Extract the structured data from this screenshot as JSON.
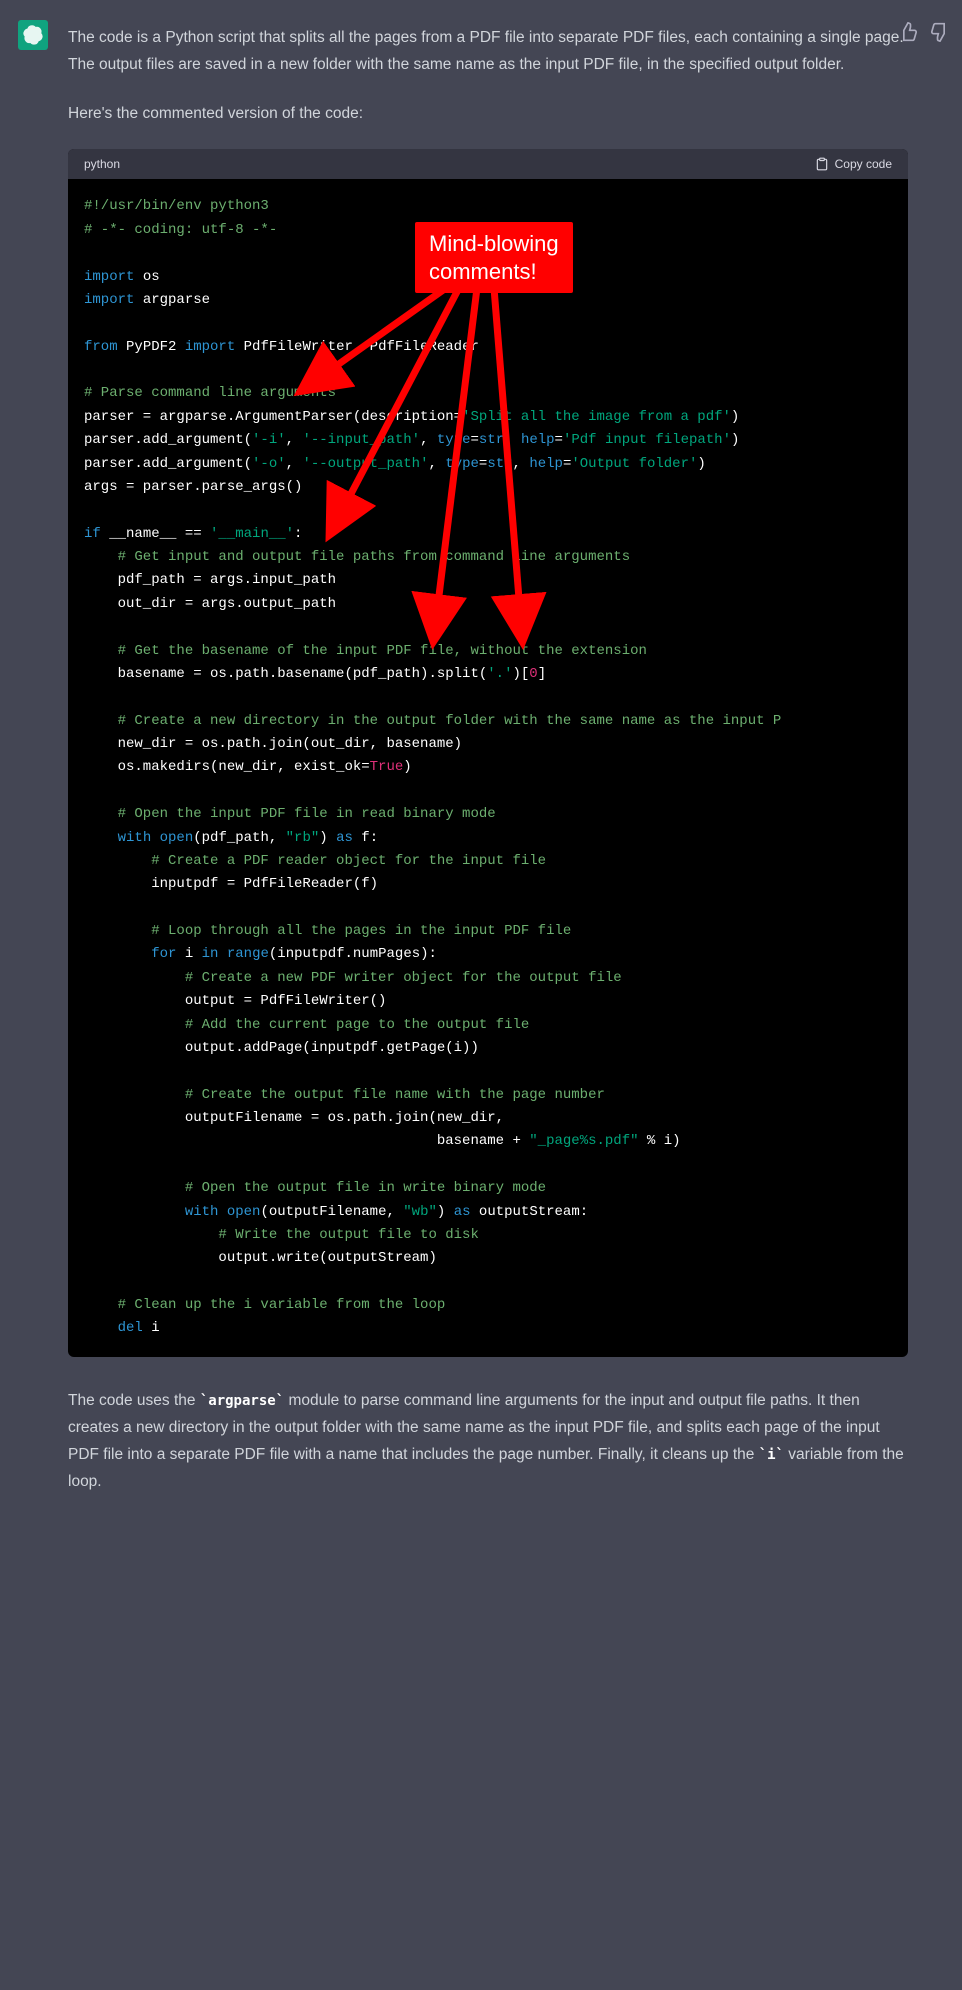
{
  "assistant": {
    "para1": "The code is a Python script that splits all the pages from a PDF file into separate PDF files, each containing a single page. The output files are saved in a new folder with the same name as the input PDF file, in the specified output folder.",
    "para2": "Here's the commented version of the code:",
    "footer_pre": "The code uses the ",
    "footer_code1": "`argparse`",
    "footer_mid": " module to parse command line arguments for the input and output file paths. It then creates a new directory in the output folder with the same name as the input PDF file, and splits each page of the input PDF file into a separate PDF file with a name that includes the page number. Finally, it cleans up the ",
    "footer_code2": "`i`",
    "footer_end": " variable from the loop."
  },
  "codeblock": {
    "lang": "python",
    "copy_label": "Copy code",
    "code": {
      "l1": "#!/usr/bin/env python3",
      "l2": "# -*- coding: utf-8 -*-",
      "l3a": "import",
      "l3b": " os",
      "l4a": "import",
      "l4b": " argparse",
      "l5a": "from",
      "l5b": " PyPDF2 ",
      "l5c": "import",
      "l5d": " PdfFileWriter, PdfFileReader",
      "l6": "# Parse command line arguments",
      "l7a": "parser = argparse.ArgumentParser(description=",
      "l7b": "'Split all the image from a pdf'",
      "l7c": ")",
      "l8a": "parser.add_argument(",
      "l8b": "'-i'",
      "l8c": ", ",
      "l8d": "'--input_path'",
      "l8e": ", ",
      "l8f": "type",
      "l8g": "=",
      "l8h": "str",
      "l8i": ", ",
      "l8j": "help",
      "l8k": "=",
      "l8l": "'Pdf input filepath'",
      "l8m": ")",
      "l9a": "parser.add_argument(",
      "l9b": "'-o'",
      "l9c": ", ",
      "l9d": "'--output_path'",
      "l9e": ", ",
      "l9f": "type",
      "l9g": "=",
      "l9h": "str",
      "l9i": ", ",
      "l9j": "help",
      "l9k": "=",
      "l9l": "'Output folder'",
      "l9m": ")",
      "l10": "args = parser.parse_args()",
      "l11a": "if",
      "l11b": " __name__ == ",
      "l11c": "'__main__'",
      "l11d": ":",
      "l12": "    # Get input and output file paths from command line arguments",
      "l13": "    pdf_path = args.input_path",
      "l14": "    out_dir = args.output_path",
      "l15": "    # Get the basename of the input PDF file, without the extension",
      "l16a": "    basename = os.path.basename(pdf_path).split(",
      "l16b": "'.'",
      "l16c": ")[",
      "l16d": "0",
      "l16e": "]",
      "l17": "    # Create a new directory in the output folder with the same name as the input P",
      "l18": "    new_dir = os.path.join(out_dir, basename)",
      "l19a": "    os.makedirs(new_dir, exist_ok=",
      "l19b": "True",
      "l19c": ")",
      "l20": "    # Open the input PDF file in read binary mode",
      "l21a": "    ",
      "l21b": "with",
      "l21c": " ",
      "l21d": "open",
      "l21e": "(pdf_path, ",
      "l21f": "\"rb\"",
      "l21g": ") ",
      "l21h": "as",
      "l21i": " f:",
      "l22": "        # Create a PDF reader object for the input file",
      "l23": "        inputpdf = PdfFileReader(f)",
      "l24": "        # Loop through all the pages in the input PDF file",
      "l25a": "        ",
      "l25b": "for",
      "l25c": " i ",
      "l25d": "in",
      "l25e": " ",
      "l25f": "range",
      "l25g": "(inputpdf.numPages):",
      "l26": "            # Create a new PDF writer object for the output file",
      "l27": "            output = PdfFileWriter()",
      "l28": "            # Add the current page to the output file",
      "l29": "            output.addPage(inputpdf.getPage(i))",
      "l30": "            # Create the output file name with the page number",
      "l31": "            outputFilename = os.path.join(new_dir,",
      "l32a": "                                          basename + ",
      "l32b": "\"_page%s.pdf\"",
      "l32c": " % i)",
      "l33": "            # Open the output file in write binary mode",
      "l34a": "            ",
      "l34b": "with",
      "l34c": " ",
      "l34d": "open",
      "l34e": "(outputFilename, ",
      "l34f": "\"wb\"",
      "l34g": ") ",
      "l34h": "as",
      "l34i": " outputStream:",
      "l35": "                # Write the output file to disk",
      "l36": "                output.write(outputStream)",
      "l37": "    # Clean up the i variable from the loop",
      "l38a": "    ",
      "l38b": "del",
      "l38c": " i"
    }
  },
  "annotation": {
    "callout_line1": "Mind-blowing",
    "callout_line2": "comments!"
  }
}
